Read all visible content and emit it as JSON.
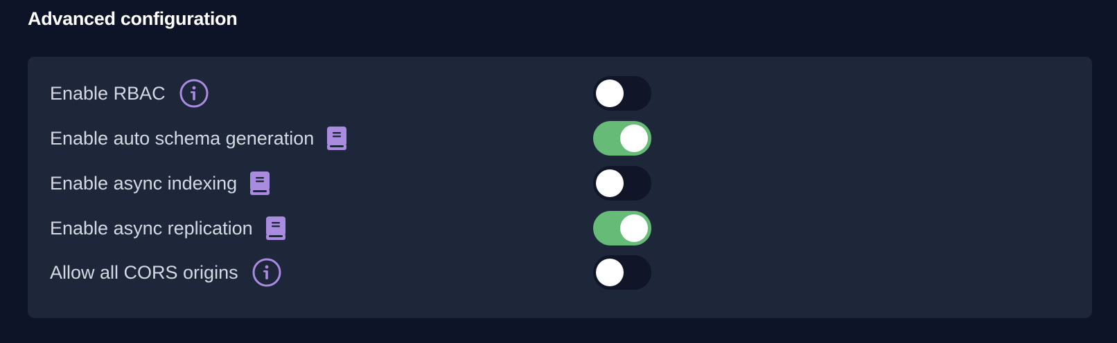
{
  "section": {
    "title": "Advanced configuration"
  },
  "colors": {
    "background": "#0e1428",
    "card": "#1e273a",
    "toggle_on": "#66bb77",
    "toggle_off": "#101628",
    "icon_accent": "#a98be0"
  },
  "settings": [
    {
      "label": "Enable RBAC",
      "icon": "info-icon",
      "enabled": false
    },
    {
      "label": "Enable auto schema generation",
      "icon": "book-icon",
      "enabled": true
    },
    {
      "label": "Enable async indexing",
      "icon": "book-icon",
      "enabled": false
    },
    {
      "label": "Enable async replication",
      "icon": "book-icon",
      "enabled": true
    },
    {
      "label": "Allow all CORS origins",
      "icon": "info-icon",
      "enabled": false
    }
  ]
}
